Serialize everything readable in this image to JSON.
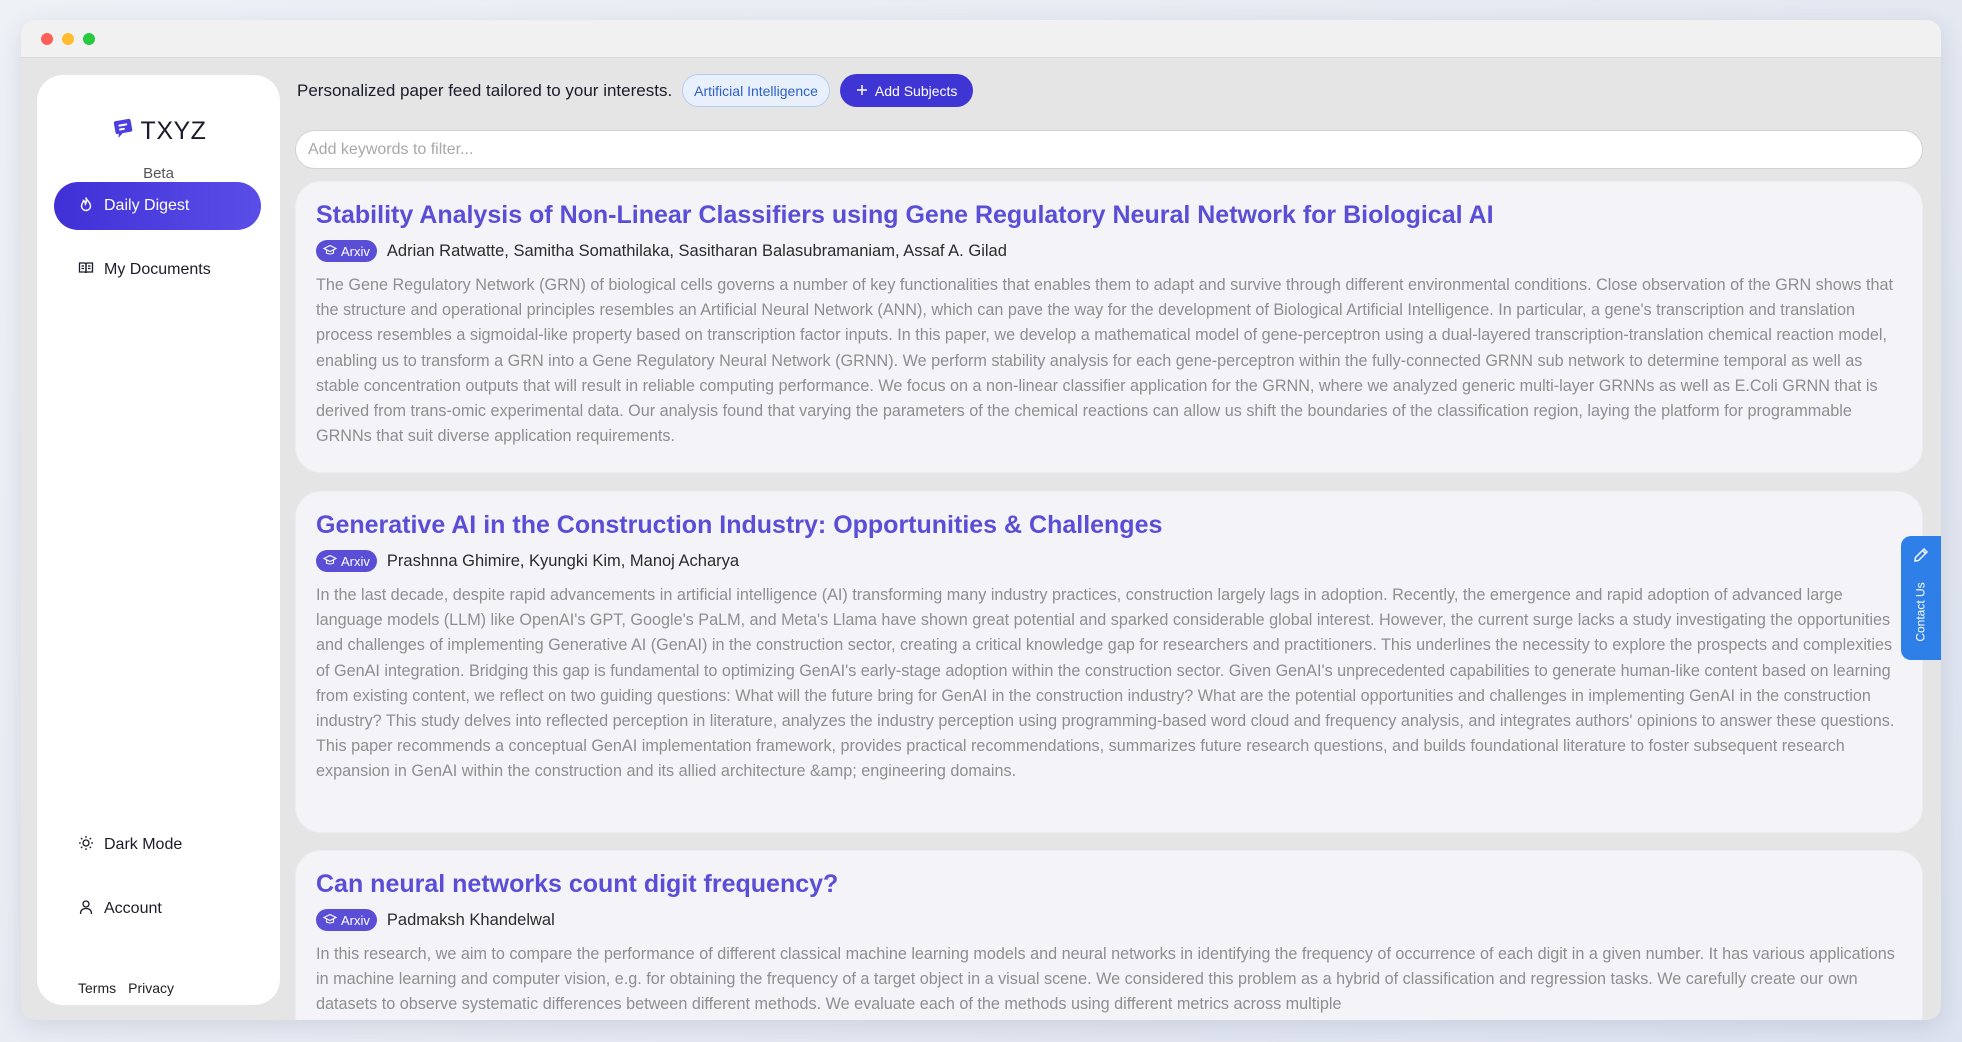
{
  "sidebar": {
    "brand": "TXYZ",
    "badge": "Beta",
    "nav": {
      "daily_digest": "Daily Digest",
      "my_documents": "My Documents",
      "dark_mode": "Dark Mode",
      "account": "Account"
    },
    "footer": {
      "terms": "Terms",
      "privacy": "Privacy"
    }
  },
  "header": {
    "tagline": "Personalized paper feed tailored to your interests.",
    "subject": "Artificial Intelligence",
    "add_subjects": "Add Subjects"
  },
  "filter": {
    "placeholder": "Add keywords to filter...",
    "value": ""
  },
  "papers": [
    {
      "title": "Stability Analysis of Non-Linear Classifiers using Gene Regulatory Neural Network for Biological AI",
      "source": "Arxiv",
      "authors": "Adrian Ratwatte, Samitha Somathilaka, Sasitharan Balasubramaniam, Assaf A. Gilad",
      "abstract": "The Gene Regulatory Network (GRN) of biological cells governs a number of key functionalities that enables them to adapt and survive through different environmental conditions. Close observation of the GRN shows that the structure and operational principles resembles an Artificial Neural Network (ANN), which can pave the way for the development of Biological Artificial Intelligence. In particular, a gene's transcription and translation process resembles a sigmoidal-like property based on transcription factor inputs. In this paper, we develop a mathematical model of gene-perceptron using a dual-layered transcription-translation chemical reaction model, enabling us to transform a GRN into a Gene Regulatory Neural Network (GRNN). We perform stability analysis for each gene-perceptron within the fully-connected GRNN sub network to determine temporal as well as stable concentration outputs that will result in reliable computing performance. We focus on a non-linear classifier application for the GRNN, where we analyzed generic multi-layer GRNNs as well as E.Coli GRNN that is derived from trans-omic experimental data. Our analysis found that varying the parameters of the chemical reactions can allow us shift the boundaries of the classification region, laying the platform for programmable GRNNs that suit diverse application requirements."
    },
    {
      "title": "Generative AI in the Construction Industry: Opportunities & Challenges",
      "source": "Arxiv",
      "authors": "Prashnna Ghimire, Kyungki Kim, Manoj Acharya",
      "abstract": "In the last decade, despite rapid advancements in artificial intelligence (AI) transforming many industry practices, construction largely lags in adoption. Recently, the emergence and rapid adoption of advanced large language models (LLM) like OpenAI's GPT, Google's PaLM, and Meta's Llama have shown great potential and sparked considerable global interest. However, the current surge lacks a study investigating the opportunities and challenges of implementing Generative AI (GenAI) in the construction sector, creating a critical knowledge gap for researchers and practitioners. This underlines the necessity to explore the prospects and complexities of GenAI integration. Bridging this gap is fundamental to optimizing GenAI's early-stage adoption within the construction sector. Given GenAI's unprecedented capabilities to generate human-like content based on learning from existing content, we reflect on two guiding questions: What will the future bring for GenAI in the construction industry? What are the potential opportunities and challenges in implementing GenAI in the construction industry? This study delves into reflected perception in literature, analyzes the industry perception using programming-based word cloud and frequency analysis, and integrates authors' opinions to answer these questions. This paper recommends a conceptual GenAI implementation framework, provides practical recommendations, summarizes future research questions, and builds foundational literature to foster subsequent research expansion in GenAI within the construction and its allied architecture &amp; engineering domains."
    },
    {
      "title": "Can neural networks count digit frequency?",
      "source": "Arxiv",
      "authors": "Padmaksh Khandelwal",
      "abstract": "In this research, we aim to compare the performance of different classical machine learning models and neural networks in identifying the frequency of occurrence of each digit in a given number. It has various applications in machine learning and computer vision, e.g. for obtaining the frequency of a target object in a visual scene. We considered this problem as a hybrid of classification and regression tasks. We carefully create our own datasets to observe systematic differences between different methods. We evaluate each of the methods using different metrics across multiple"
    }
  ],
  "contact": {
    "label": "Contact Us"
  },
  "colors": {
    "accent": "#3f34d4",
    "title_link": "#5a4ed6",
    "contact_tab": "#2f7fe8",
    "abstract_text": "#8e8e8e"
  },
  "icons": {
    "brand": "chat-bubble-icon",
    "daily_digest": "flame-icon",
    "my_documents": "open-book-icon",
    "dark_mode": "sun-icon",
    "account": "user-icon",
    "add_subjects": "plus-icon",
    "badge": "graduation-cap-icon",
    "contact": "pencil-icon"
  }
}
